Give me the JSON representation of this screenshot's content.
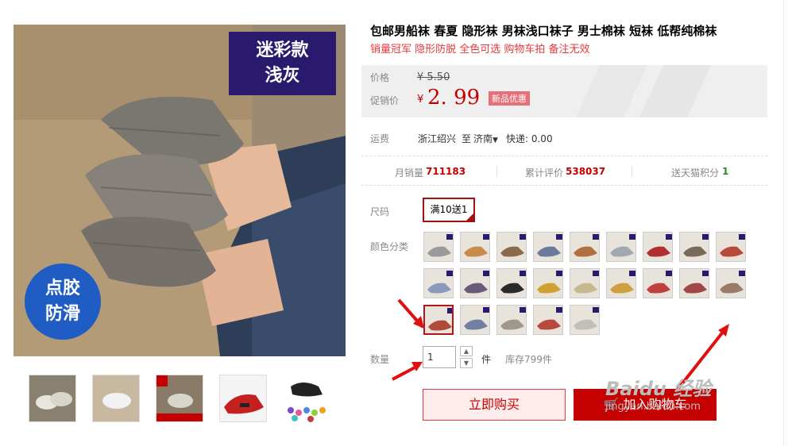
{
  "product": {
    "title": "包邮男船袜 春夏 隐形袜 男袜浅口袜子 男士棉袜 短袜 低帮纯棉袜",
    "subtitle": "销量冠军 隐形防脱 全色可选 购物车拍 备注无效"
  },
  "main_image": {
    "badge_top_line1": "迷彩款",
    "badge_top_line2": "浅灰",
    "badge_circle_line1": "点胶",
    "badge_circle_line2": "防滑"
  },
  "price": {
    "label": "价格",
    "original": "¥ 5.50",
    "promo_label": "促销价",
    "currency": "¥",
    "value": "2. 99",
    "promo_tag": "新品优惠"
  },
  "shipping": {
    "label": "运费",
    "from": "浙江绍兴",
    "to_word": "至",
    "dest": "济南",
    "express": "快递: 0.00"
  },
  "stats": {
    "monthly_label": "月销量",
    "monthly_value": "711183",
    "reviews_label": "累计评价",
    "reviews_value": "538037",
    "points_label": "送天猫积分",
    "points_value": "1"
  },
  "size": {
    "label": "尺码",
    "option": "满10送1"
  },
  "color": {
    "label": "颜色分类",
    "swatch_colors": [
      "#9a9a9a",
      "#c98b4a",
      "#8a6a4a",
      "#6a7a9a",
      "#b07040",
      "#a0a8b0",
      "#b03030",
      "#7a6a5a",
      "#b84a3a",
      "#8a9ab8",
      "#6a5a7a",
      "#2a2a2a",
      "#d0a030",
      "#c8b890",
      "#d0a040",
      "#c04040",
      "#a04848",
      "#9a7a6a",
      "#b04a3a",
      "#7080a0",
      "#a09888",
      "#b84a40",
      "#c0c0b8"
    ]
  },
  "quantity": {
    "label": "数量",
    "value": "1",
    "unit": "件",
    "stock": "库存799件"
  },
  "actions": {
    "buy_now": "立即购买",
    "add_cart": "加入购物车"
  },
  "watermark": {
    "line1": "Baidu 经验",
    "line2": "jingyan.baidu.com"
  }
}
